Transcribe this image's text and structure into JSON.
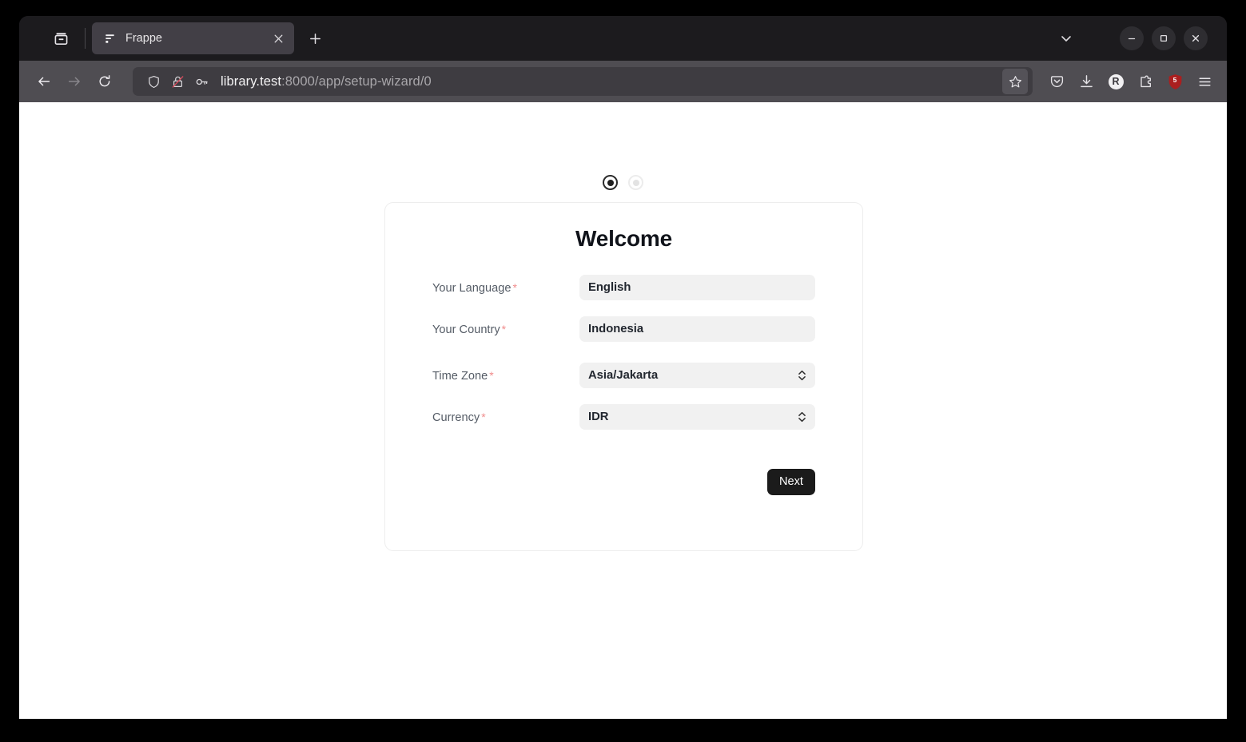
{
  "browser": {
    "firefox_view_label": "Firefox View",
    "tab": {
      "title": "Frappe",
      "favicon_name": "frappe-logo-icon",
      "close_label": "×"
    },
    "new_tab_label": "+",
    "window_controls": {
      "tab_list_label": "List all tabs",
      "minimize_label": "Minimize",
      "maximize_label": "Maximize",
      "close_label": "Close"
    },
    "nav": {
      "back_label": "Back",
      "forward_label": "Forward",
      "reload_label": "Reload"
    },
    "url": {
      "host": "library.test",
      "path": ":8000/app/setup-wizard/0",
      "full": "library.test:8000/app/setup-wizard/0",
      "shield_icon": "tracking-protection-shield-icon",
      "permission_icon": "broken-lock-icon",
      "key_icon": "saved-logins-key-icon"
    },
    "toolbar": {
      "bookmark_label": "Bookmark this page",
      "pocket_label": "Save to Pocket",
      "downloads_label": "Downloads",
      "account_initial": "R",
      "extensions_label": "Extensions",
      "ublock_badge": "5",
      "menu_label": "Open application menu"
    }
  },
  "page": {
    "steps": [
      {
        "name": "step-1",
        "state": "active"
      },
      {
        "name": "step-2",
        "state": "inactive"
      }
    ],
    "card": {
      "title": "Welcome",
      "fields": [
        {
          "label": "Your Language",
          "required": "*",
          "value": "English",
          "type": "autocomplete",
          "name": "your-language"
        },
        {
          "label": "Your Country",
          "required": "*",
          "value": "Indonesia",
          "type": "autocomplete",
          "name": "your-country"
        },
        {
          "label": "Time Zone",
          "required": "*",
          "value": "Asia/Jakarta",
          "type": "select",
          "name": "time-zone"
        },
        {
          "label": "Currency",
          "required": "*",
          "value": "IDR",
          "type": "select",
          "name": "currency"
        }
      ],
      "next_label": "Next"
    }
  },
  "colors": {
    "accent_dark": "#1b1b1b",
    "required_star": "#f08c8c",
    "input_bg": "#f1f1f1",
    "card_border": "#ededed",
    "ublock_red": "#ab1f1f"
  }
}
